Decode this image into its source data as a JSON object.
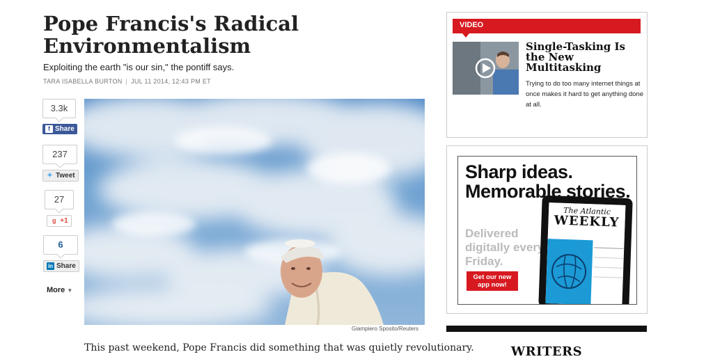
{
  "article": {
    "title": "Pope Francis's Radical Environmentalism",
    "dek": "Exploiting the earth \"is our sin,\" the pontiff says.",
    "author": "TARA ISABELLA BURTON",
    "separator": "|",
    "date": "JUL 11 2014, 12:43 PM ET",
    "photo_credit": "Giampiero Sposito/Reuters",
    "body_first_line": "This past weekend, Pope Francis did something that was quietly revolutionary."
  },
  "share": {
    "facebook": {
      "count": "3.3k",
      "label": "Share",
      "icon": "facebook-icon"
    },
    "twitter": {
      "count": "237",
      "label": "Tweet",
      "icon": "twitter-bird-icon"
    },
    "google": {
      "count": "27",
      "label": "+1",
      "icon": "google-plus-icon"
    },
    "linkedin": {
      "count": "6",
      "label": "Share",
      "icon": "linkedin-icon"
    },
    "more_label": "More"
  },
  "video": {
    "label": "VIDEO",
    "title": "Single-Tasking Is the New Multitasking",
    "description": "Trying to do too many internet things at once makes it hard to get anything done at all."
  },
  "ad": {
    "headline": "Sharp ideas. Memorable stories.",
    "subline": "Delivered digitally every Friday.",
    "cta": "Get our new app now!",
    "magazine_the": "The Atlantic",
    "magazine_name": "WEEKLY"
  },
  "sidebar": {
    "writers_heading": "WRITERS"
  },
  "colors": {
    "accent_red": "#d71920",
    "facebook_blue": "#3b5998",
    "sky_blue": "#6b9fd0"
  }
}
